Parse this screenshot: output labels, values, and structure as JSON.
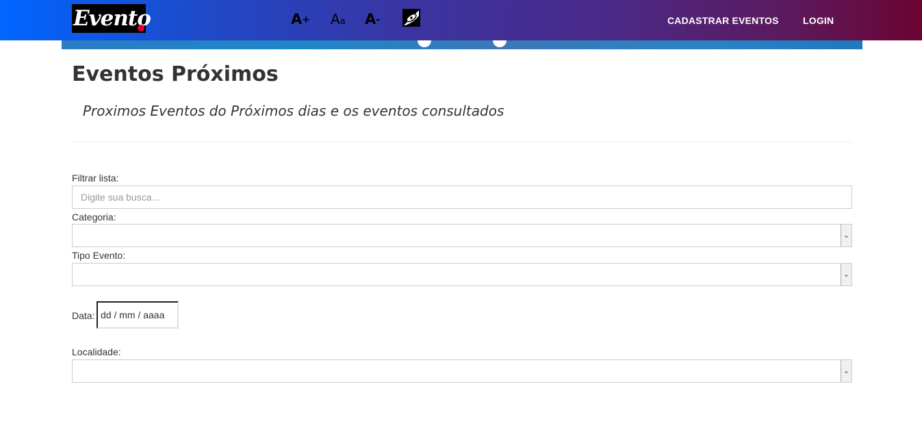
{
  "navbar": {
    "logo_text": "Evento",
    "font_increase": "A",
    "font_increase_sign": "+",
    "font_normal": "A",
    "font_normal_small": "a",
    "font_decrease": "A",
    "font_decrease_sign": "-",
    "contrast_icon": "contrast-icon",
    "links": [
      "CADASTRAR EVENTOS",
      "LOGIN"
    ]
  },
  "page": {
    "title": "Eventos Próximos",
    "lead": "Proximos Eventos do Próximos dias e os eventos consultados"
  },
  "filters": {
    "search_label": "Filtrar lista:",
    "search_placeholder": "Digite sua busca...",
    "category_label": "Categoria:",
    "category_value": "",
    "type_label": "Tipo Evento:",
    "type_value": "",
    "date_label": "Data:",
    "date_placeholder": "dd / mm / aaaa",
    "location_label": "Localidade:",
    "location_value": ""
  }
}
